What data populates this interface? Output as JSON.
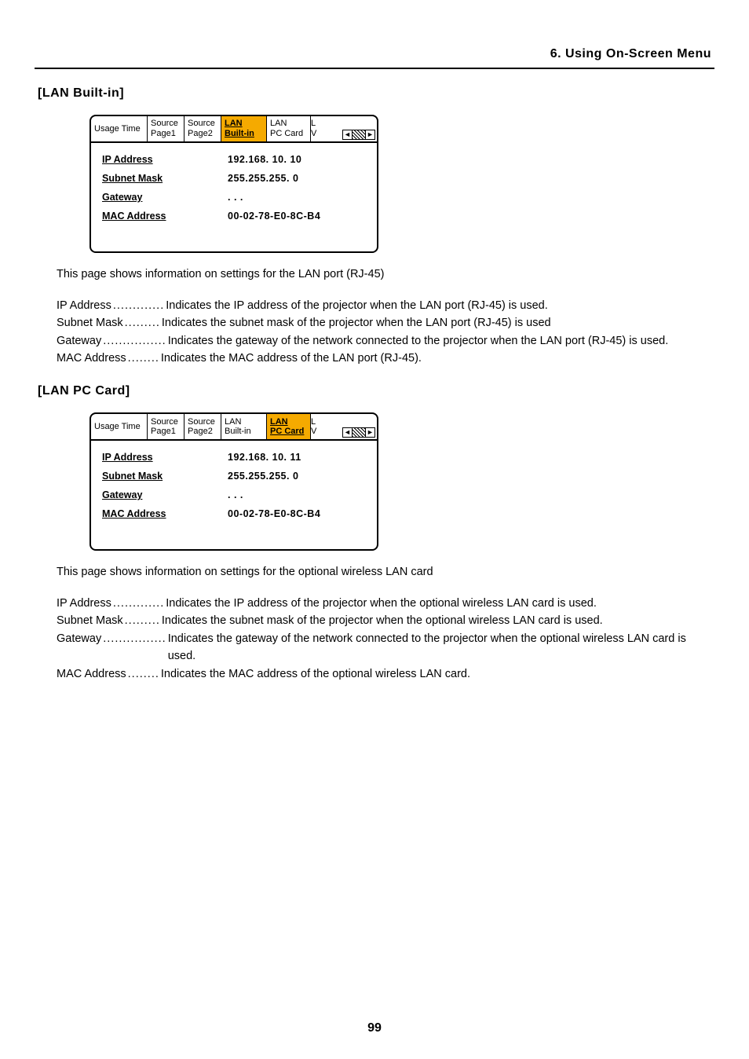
{
  "header": {
    "title": "6. Using On-Screen Menu"
  },
  "section1": {
    "heading": "[LAN Built-in]",
    "tabs": {
      "t0": "Usage Time",
      "t1a": "Source",
      "t1b": "Page1",
      "t2a": "Source",
      "t2b": "Page2",
      "t3a": "LAN",
      "t3b": "Built-in",
      "t4a": "LAN",
      "t4b": "PC Card",
      "t5a": "L",
      "t5b": "V"
    },
    "rows": {
      "ip_label": "IP Address",
      "ip_value": "192.168. 10. 10",
      "sm_label": "Subnet Mask",
      "sm_value": "255.255.255.  0",
      "gw_label": "Gateway",
      "gw_value": "   .   .   .",
      "mac_label": "MAC Address",
      "mac_value": "00-02-78-E0-8C-B4"
    },
    "desc": "This page shows information on settings for the LAN port (RJ-45)",
    "defs": {
      "ip": {
        "term": "IP Address",
        "dots": ".............",
        "body": "Indicates the IP address of the projector when the LAN port (RJ-45) is used."
      },
      "sm": {
        "term": "Subnet Mask",
        "dots": ".........",
        "body": "Indicates the subnet mask of the projector when the LAN port (RJ-45) is used"
      },
      "gw": {
        "term": "Gateway",
        "dots": "................",
        "body": "Indicates the gateway of the network connected to the projector when the LAN port (RJ-45) is used."
      },
      "mac": {
        "term": "MAC Address",
        "dots": "........",
        "body": "Indicates the MAC address of the LAN port (RJ-45)."
      }
    }
  },
  "section2": {
    "heading": "[LAN PC Card]",
    "tabs": {
      "t0": "Usage Time",
      "t1a": "Source",
      "t1b": "Page1",
      "t2a": "Source",
      "t2b": "Page2",
      "t3a": "LAN",
      "t3b": "Built-in",
      "t4a": "LAN",
      "t4b": "PC Card",
      "t5a": "L",
      "t5b": "V"
    },
    "rows": {
      "ip_label": "IP Address",
      "ip_value": "192.168. 10. 11",
      "sm_label": "Subnet Mask",
      "sm_value": "255.255.255.  0",
      "gw_label": "Gateway",
      "gw_value": "   .   .   .",
      "mac_label": "MAC Address",
      "mac_value": "00-02-78-E0-8C-B4"
    },
    "desc": "This page shows information on settings for the optional wireless LAN card",
    "defs": {
      "ip": {
        "term": "IP Address",
        "dots": ".............",
        "body": "Indicates the IP address of the projector when the optional wireless LAN card is used."
      },
      "sm": {
        "term": "Subnet Mask",
        "dots": ".........",
        "body": "Indicates the subnet mask of the projector when the optional wireless LAN card is used."
      },
      "gw": {
        "term": "Gateway",
        "dots": "................",
        "body": "Indicates the gateway of the network connected to the projector when the optional wireless LAN card is used."
      },
      "mac": {
        "term": "MAC Address",
        "dots": "........",
        "body": "Indicates the MAC address of the optional wireless LAN card."
      }
    }
  },
  "page_number": "99",
  "glyph": {
    "left": "◄",
    "right": "►"
  }
}
